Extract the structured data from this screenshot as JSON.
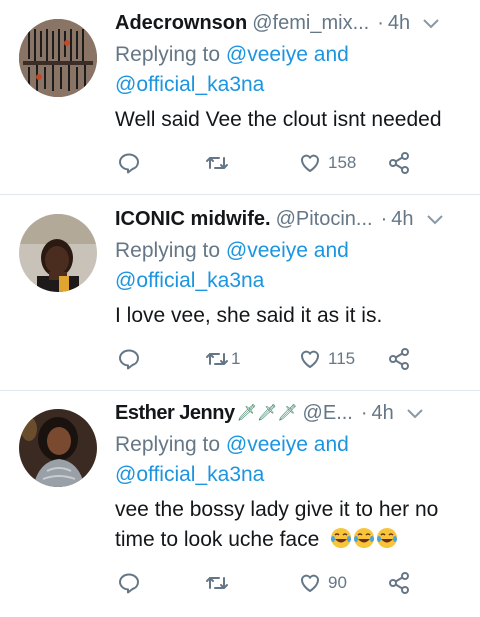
{
  "tweets": [
    {
      "name": "Adecrownson",
      "handle": "@femi_mix...",
      "dot": "·",
      "time": "4h",
      "replying_prefix": "Replying to",
      "mention1": "@veeiye",
      "and": "and",
      "mention2": "@official_ka3na",
      "text": "Well said Vee the clout isnt needed",
      "likes": "158",
      "retweets": ""
    },
    {
      "name": "ICONIC midwife.",
      "handle": "@Pitocin...",
      "dot": "·",
      "time": "4h",
      "replying_prefix": "Replying to",
      "mention1": "@veeiye",
      "and": "and",
      "mention2": "@official_ka3na",
      "text": "I love vee, she said it as it is.",
      "likes": "115",
      "retweets": "1"
    },
    {
      "name": "Esther Jenny",
      "name_emoji": "🗡🗡🗡",
      "handle": "@E...",
      "dot": "·",
      "time": "4h",
      "replying_prefix": "Replying to",
      "mention1": "@veeiye",
      "and": "and",
      "mention2": "@official_ka3na",
      "text_line1": "vee the bossy lady give it to her no",
      "text_line2": "time to look uche face",
      "likes": "90",
      "retweets": ""
    }
  ],
  "icons": {
    "reply": "reply-icon",
    "retweet": "retweet-icon",
    "like": "heart-icon",
    "share": "share-icon",
    "menu": "chevron-down-icon"
  },
  "colors": {
    "link": "#1b95e0",
    "muted": "#657786",
    "text": "#14171a",
    "divider": "#e1e8ed"
  }
}
